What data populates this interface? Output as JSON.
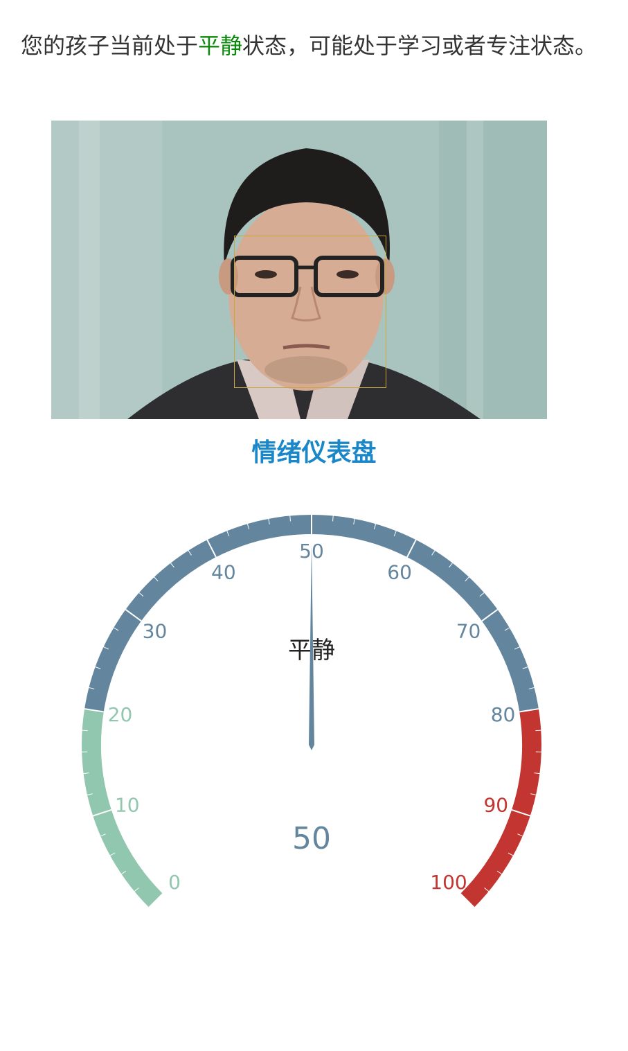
{
  "status": {
    "prefix": "您的孩子当前处于",
    "state_word": "平静",
    "suffix": "状态，可能处于学习或者专注状态。",
    "state_color": "#0a8a0a"
  },
  "photo": {
    "face_box_color": "#c8a640"
  },
  "gauge": {
    "title": "情绪仪表盘",
    "title_color": "#1a87c9",
    "min": 0,
    "max": 100,
    "value": 50,
    "value_label": "50",
    "detail_label": "平静",
    "tick_labels": [
      "0",
      "10",
      "20",
      "30",
      "40",
      "50",
      "60",
      "70",
      "80",
      "90",
      "100"
    ],
    "bands": [
      {
        "to": 20,
        "color": "#91c7ae"
      },
      {
        "to": 80,
        "color": "#63869e"
      },
      {
        "to": 100,
        "color": "#c23531"
      }
    ],
    "pointer_color": "#63869e"
  }
}
